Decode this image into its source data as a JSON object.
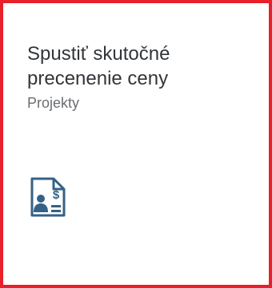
{
  "tile": {
    "title_line1": "Spustiť skutočné",
    "title_line2": "precenenie ceny",
    "subtitle": "Projekty",
    "icon": "price-document-icon",
    "border_color": "#e8202a",
    "icon_color": "#346187"
  }
}
